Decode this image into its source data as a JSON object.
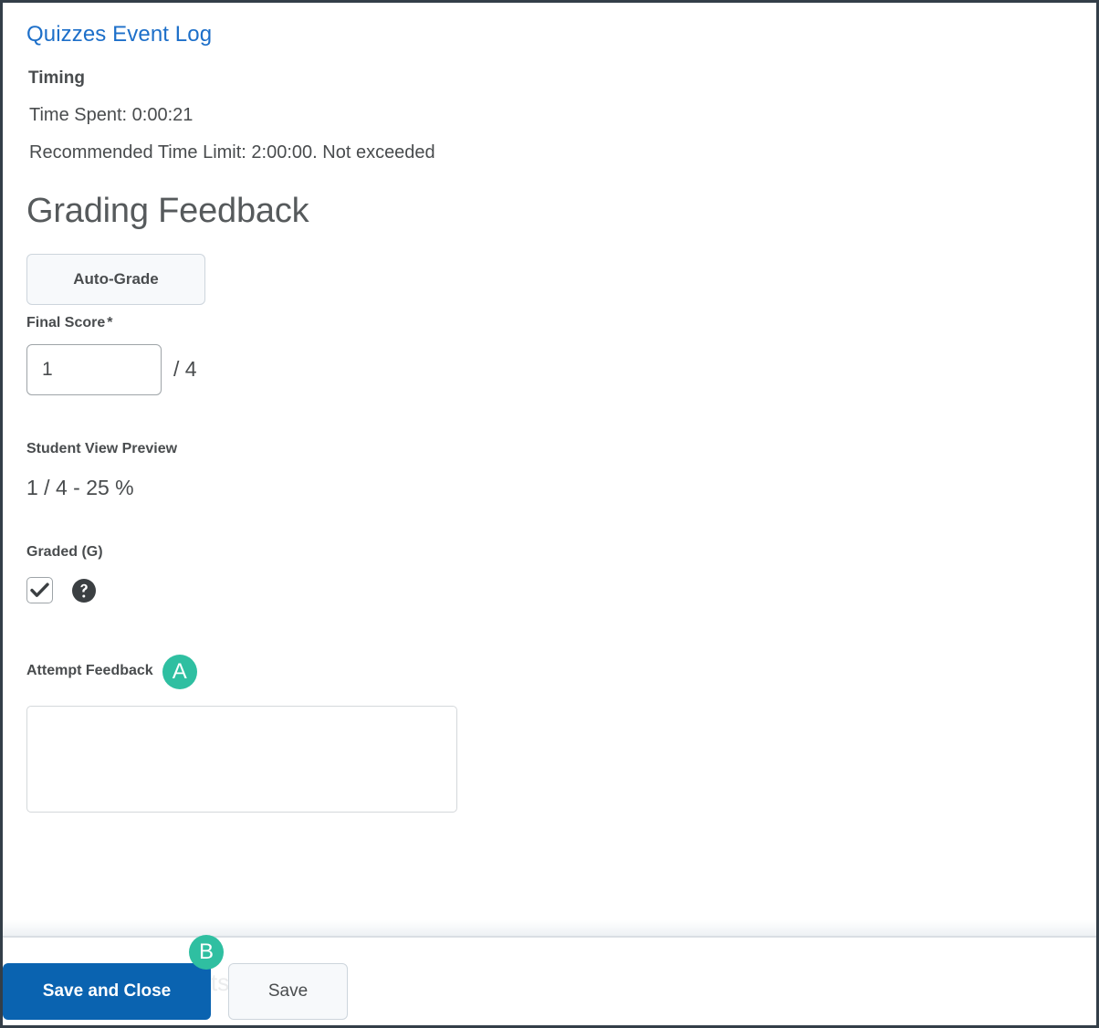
{
  "window": {
    "border_color": "#333e48"
  },
  "header": {
    "event_log_link": "Quizzes Event Log",
    "link_color": "#1d6fc9"
  },
  "timing": {
    "heading": "Timing",
    "time_spent": "Time Spent: 0:00:21",
    "time_limit": "Recommended Time Limit: 2:00:00. Not exceeded"
  },
  "grading": {
    "section_title": "Grading Feedback",
    "auto_grade_label": "Auto-Grade",
    "final_score_label": "Final Score",
    "required_marker": "*",
    "final_score_value": "1",
    "final_score_placeholder": "",
    "score_denominator": "/ 4",
    "student_view_label": "Student View Preview",
    "student_view_value": "1 / 4 - 25 %",
    "graded_label": "Graded (G)",
    "graded_checked": true,
    "help_icon_name": "help-circle-icon",
    "check_icon_name": "checkmark-icon"
  },
  "attempt_feedback": {
    "label": "Attempt Feedback",
    "value": "",
    "placeholder": ""
  },
  "callouts": [
    {
      "id": "A",
      "label": "A",
      "color": "#2fbfa1",
      "target": "attempt-feedback"
    },
    {
      "id": "B",
      "label": "B",
      "color": "#2fbfa1",
      "target": "save-and-close"
    }
  ],
  "footer": {
    "save_and_close_label": "Save and Close",
    "save_label": "Save",
    "obscured_text": "ts",
    "primary_color": "#0a63b0"
  }
}
